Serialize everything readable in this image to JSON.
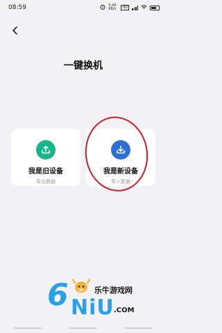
{
  "status_bar": {
    "time": "08:59",
    "indicators": [
      "alarm-icon",
      "speed-text",
      "hd-icon",
      "signal-icon",
      "wifi-icon",
      "battery-icon"
    ],
    "speed": "3.40 KB/s"
  },
  "header": {
    "back_icon": "chevron-left-icon",
    "title": "一键换机"
  },
  "cards": [
    {
      "title": "我是旧设备",
      "subtitle": "导出数据",
      "icon": "upload-tray-icon",
      "color": "#18b48a"
    },
    {
      "title": "我是新设备",
      "subtitle": "导入数据",
      "icon": "download-tray-icon",
      "color": "#2f6fd4"
    }
  ],
  "annotation_color": "#d11a25",
  "watermark": {
    "logo_text": "6NiU",
    "brand": "乐牛游戏网",
    "domain": ".COM",
    "color": "#2aa0e8"
  }
}
